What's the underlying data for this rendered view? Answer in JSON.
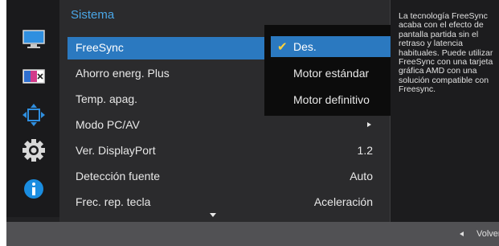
{
  "menu": {
    "title": "Sistema",
    "items": [
      {
        "label": "FreeSync",
        "value": ""
      },
      {
        "label": "Ahorro energ. Plus",
        "value": ""
      },
      {
        "label": "Temp. apag.",
        "value": ""
      },
      {
        "label": "Modo PC/AV",
        "value": ""
      },
      {
        "label": "Ver. DisplayPort",
        "value": "1.2"
      },
      {
        "label": "Detección fuente",
        "value": "Auto"
      },
      {
        "label": "Frec. rep. tecla",
        "value": "Aceleración"
      }
    ]
  },
  "submenu": {
    "options": [
      "Des.",
      "Motor estándar",
      "Motor definitivo"
    ],
    "selected": "Des."
  },
  "help": {
    "text": "La tecnología FreeSync acaba con el efecto de pantalla partida sin el retraso y latencia habituales. Puede utilizar FreeSync con una tarjeta gráfica AMD con una solución compatible con Freesync."
  },
  "footer": {
    "back_label": "Volver"
  },
  "icons": [
    "picture-icon",
    "color-icon",
    "position-size-icon",
    "system-gear-icon",
    "information-icon"
  ],
  "colors": {
    "highlight": "#2b79c0",
    "title": "#4aa6e6",
    "check": "#ffd23a",
    "info": "#1a8de0"
  }
}
